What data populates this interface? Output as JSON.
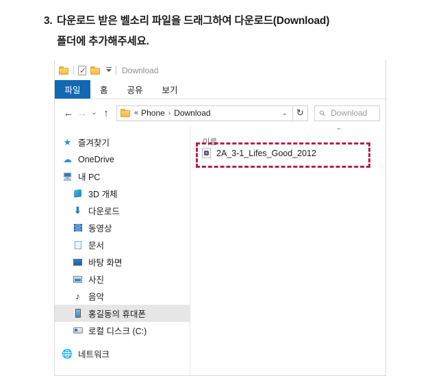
{
  "instruction": {
    "number": "3.",
    "line1": "다운로드 받은 벨소리 파일을 드래그하여 다운로드(Download)",
    "line2": "폴더에 추가해주세요."
  },
  "explorer": {
    "titlebar": {
      "title": "Download",
      "qat": [
        {
          "name": "folder-icon",
          "label": "폴더"
        },
        {
          "name": "properties-icon",
          "label": "속성"
        },
        {
          "name": "new-folder-icon",
          "label": "새 폴더"
        },
        {
          "name": "customize-qat-icon",
          "label": "빠른 실행 도구 모음 사용자 지정"
        }
      ]
    },
    "ribbon_tabs": [
      {
        "label": "파일",
        "active": true
      },
      {
        "label": "홈",
        "active": false
      },
      {
        "label": "공유",
        "active": false
      },
      {
        "label": "보기",
        "active": false
      }
    ],
    "addressbar": {
      "back_icon": "←",
      "forward_icon": "→",
      "history_icon": "⌄",
      "up_icon": "↑",
      "breadcrumb_overflow": "«",
      "breadcrumbs": [
        "Phone",
        "Download"
      ],
      "breadcrumb_separator": "›",
      "path_dropdown_icon": "⌄",
      "refresh_icon": "↻",
      "search_value": "Download",
      "search_placeholder": "Download 검색"
    },
    "sidebar": [
      {
        "label": "즐겨찾기",
        "icon": "star-icon",
        "selected": false,
        "indent": false
      },
      {
        "label": "OneDrive",
        "icon": "cloud-icon",
        "selected": false,
        "indent": false
      },
      {
        "label": "내 PC",
        "icon": "computer-icon",
        "selected": false,
        "indent": false
      },
      {
        "label": "3D 개체",
        "icon": "3d-objects-icon",
        "selected": false,
        "indent": true
      },
      {
        "label": "다운로드",
        "icon": "downloads-icon",
        "selected": false,
        "indent": true
      },
      {
        "label": "동영상",
        "icon": "videos-icon",
        "selected": false,
        "indent": true
      },
      {
        "label": "문서",
        "icon": "documents-icon",
        "selected": false,
        "indent": true
      },
      {
        "label": "바탕 화면",
        "icon": "desktop-icon",
        "selected": false,
        "indent": true
      },
      {
        "label": "사진",
        "icon": "pictures-icon",
        "selected": false,
        "indent": true
      },
      {
        "label": "음악",
        "icon": "music-icon",
        "selected": false,
        "indent": true
      },
      {
        "label": "홍길동의 휴대폰",
        "icon": "phone-icon",
        "selected": true,
        "indent": true
      },
      {
        "label": "로컬 디스크 (C:)",
        "icon": "disk-icon",
        "selected": false,
        "indent": true
      },
      {
        "label": "네트워크",
        "icon": "network-icon",
        "selected": false,
        "indent": false
      }
    ],
    "content": {
      "column_header": "이름",
      "collapse_icon": "⌃",
      "files": [
        {
          "name": "2A_3-1_Lifes_Good_2012",
          "icon": "media-file-icon"
        }
      ]
    }
  },
  "colors": {
    "tab_active_bg": "#1168b3",
    "highlight_border": "#bb1b52",
    "selection_bg": "#e6e6e6",
    "folder_yellow": "#f5bb43"
  }
}
